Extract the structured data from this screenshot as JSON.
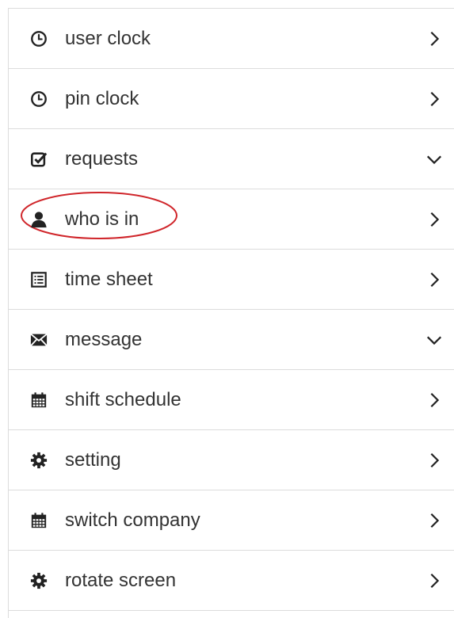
{
  "menu": {
    "items": [
      {
        "label": "user clock",
        "icon": "clock-icon",
        "indicator": "chevron-right"
      },
      {
        "label": "pin clock",
        "icon": "clock-icon",
        "indicator": "chevron-right"
      },
      {
        "label": "requests",
        "icon": "checkbox-icon",
        "indicator": "chevron-down"
      },
      {
        "label": "who is in",
        "icon": "user-icon",
        "indicator": "chevron-right",
        "highlighted": true
      },
      {
        "label": "time sheet",
        "icon": "list-icon",
        "indicator": "chevron-right"
      },
      {
        "label": "message",
        "icon": "envelope-icon",
        "indicator": "chevron-down"
      },
      {
        "label": "shift schedule",
        "icon": "calendar-icon",
        "indicator": "chevron-right"
      },
      {
        "label": "setting",
        "icon": "gear-icon",
        "indicator": "chevron-right"
      },
      {
        "label": "switch company",
        "icon": "calendar-icon",
        "indicator": "chevron-right"
      },
      {
        "label": "rotate screen",
        "icon": "gear-icon",
        "indicator": "chevron-right"
      }
    ]
  },
  "colors": {
    "text": "#333333",
    "icon": "#222222",
    "divider": "#dcdcdc",
    "highlight_ring": "#d0262b"
  }
}
